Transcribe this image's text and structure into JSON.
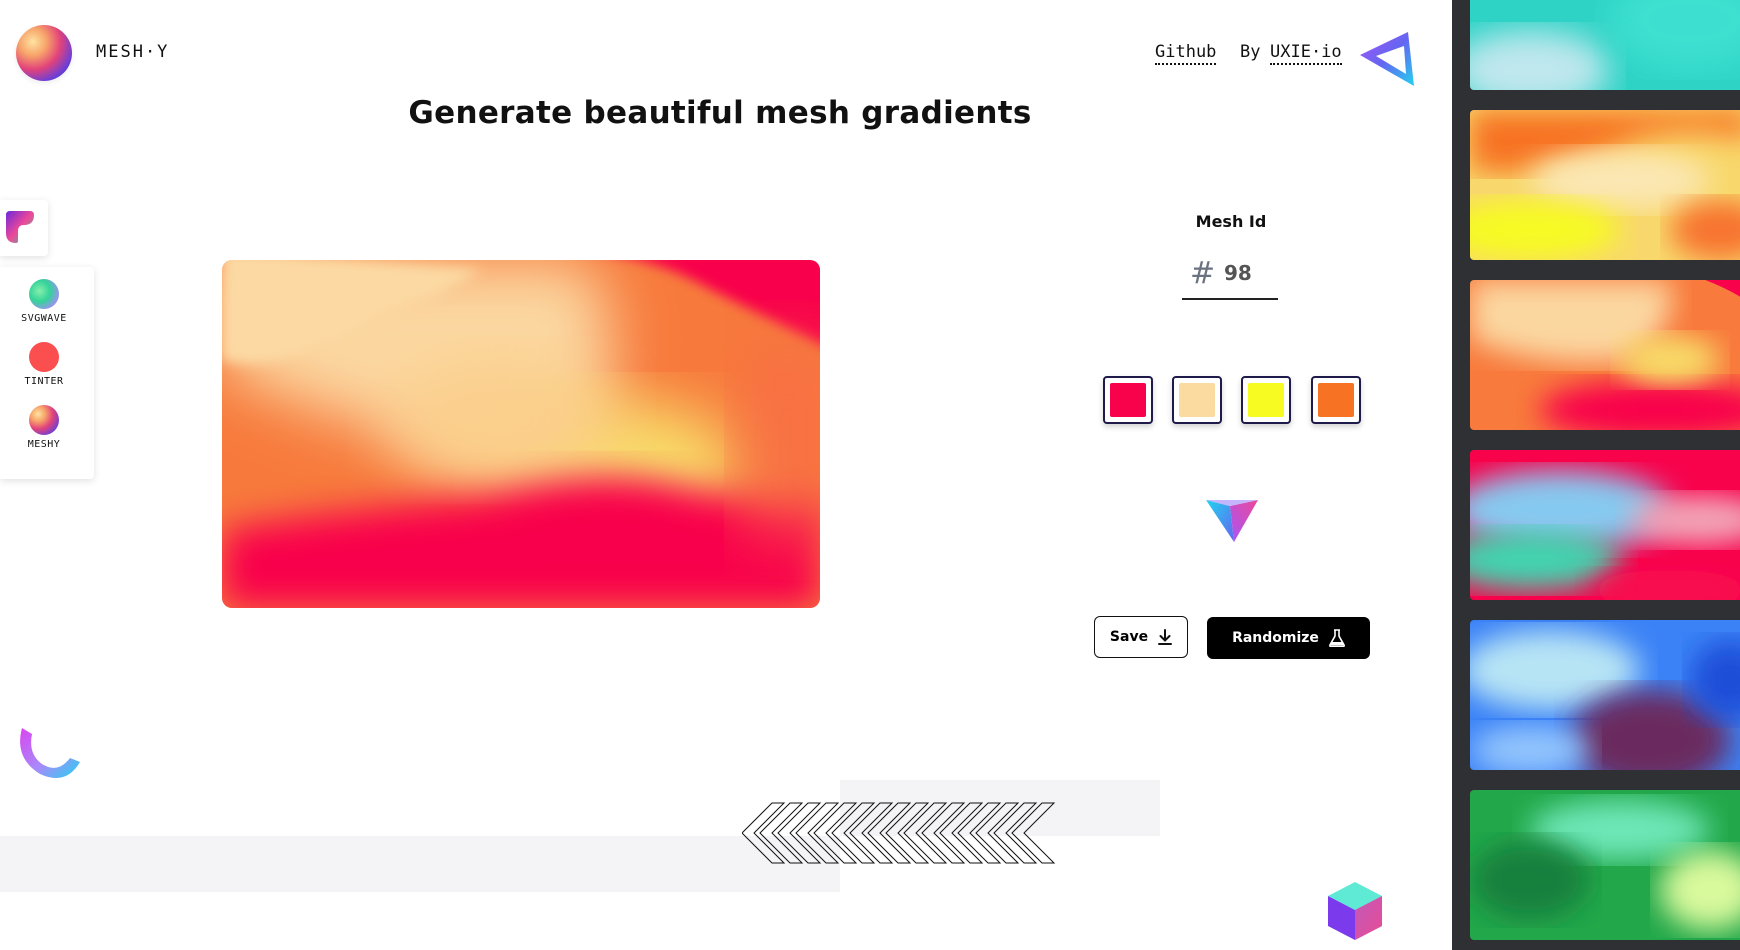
{
  "header": {
    "brand": "MESH·Y",
    "nav": {
      "github": "Github",
      "by": "By",
      "uxie": "UXIE·io"
    }
  },
  "title": "Generate beautiful mesh gradients",
  "tools": [
    {
      "label": "SVGWAVE"
    },
    {
      "label": "TINTER"
    },
    {
      "label": "MESHY"
    }
  ],
  "mesh": {
    "label": "Mesh Id",
    "hash": "#",
    "id": "98"
  },
  "palette": [
    "#f8024c",
    "#fbdba0",
    "#f7fb22",
    "#f77223"
  ],
  "actions": {
    "save": "Save",
    "randomize": "Randomize"
  },
  "gallery": {
    "count": 6
  }
}
